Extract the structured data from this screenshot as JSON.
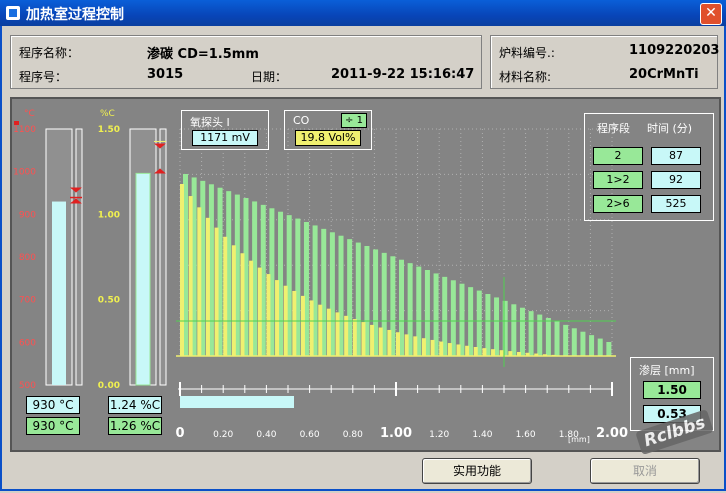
{
  "window": {
    "title": "加热室过程控制",
    "close_glyph": "✕"
  },
  "program": {
    "name_label": "程序名称：",
    "name_value": "渗碳 CD=1.5mm",
    "number_label": "程序号：",
    "number_value": "3015",
    "date_label": "日期：",
    "date_value": "2011-9-22 15:16:47"
  },
  "furnace": {
    "batch_label": "炉料编号.:",
    "batch_value": "1109220203",
    "material_label": "材料名称:",
    "material_value": "20CrMnTi"
  },
  "temp_gauge": {
    "unit": "°C",
    "ticks": [
      "1100",
      "1000",
      "900",
      "800",
      "700",
      "600",
      "500"
    ],
    "actual": 930,
    "setpoint": 930,
    "actual_text": "930 °C",
    "setpoint_text": "930 °C",
    "range": [
      500,
      1100
    ]
  },
  "carbon_gauge": {
    "unit": "%C",
    "ticks": [
      "1.50",
      "1.00",
      "0.50",
      "0.00"
    ],
    "actual": 1.24,
    "setpoint": 1.26,
    "actual_text": "1.24 %C",
    "setpoint_text": "1.26 %C",
    "range": [
      0,
      1.5
    ]
  },
  "probe": {
    "label": "氧探头 I",
    "value": "1171 mV"
  },
  "co": {
    "label": "CO",
    "factor": "÷ 1",
    "value": "19.8 Vol%"
  },
  "stages": {
    "header_stage": "程序段",
    "header_time": "时间 (分)",
    "rows": [
      {
        "stage": "2",
        "time": "87"
      },
      {
        "stage": "1>2",
        "time": "92"
      },
      {
        "stage": "2>6",
        "time": "525"
      }
    ]
  },
  "depth": {
    "label": "渗层 [mm]",
    "target": "1.50",
    "current": "0.53",
    "progress": 0.53
  },
  "profile": {
    "axis_labels": [
      "0",
      "0.20",
      "0.40",
      "0.60",
      "0.80",
      "1.00",
      "1.20",
      "1.40",
      "1.60",
      "1.80",
      "2.00"
    ],
    "unit": "[mm]",
    "marker_x": 1.5
  },
  "buttons": {
    "utility": "实用功能",
    "cancel": "取消"
  },
  "watermark": "Rclbbs",
  "colors": {
    "green": "#98e898",
    "yellow": "#f0f070",
    "cyan": "#c8f8f8",
    "panel": "#848484"
  }
}
